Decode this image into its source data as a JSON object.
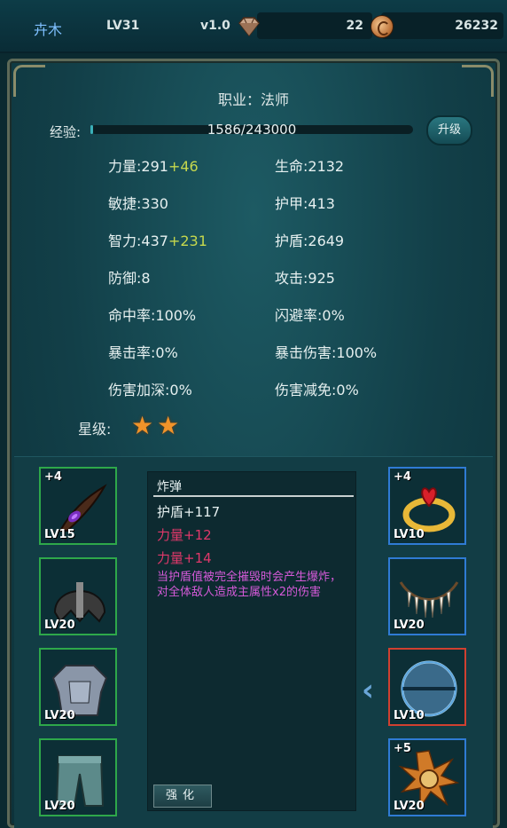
{
  "topbar": {
    "name": "卉木",
    "level": "LV31",
    "version": "v1.0",
    "gems": "22",
    "coins": "26232",
    "gem_icon": "diamond-icon",
    "coin_icon": "coin-icon"
  },
  "character": {
    "profession": "职业：法师",
    "exp_label": "经验:",
    "exp_text": "1586/243000",
    "exp_fraction": 0.0065,
    "upgrade_label": "升级"
  },
  "stats_left": [
    {
      "label": "力量:291",
      "bonus": "+46"
    },
    {
      "label": "敏捷:330",
      "bonus": ""
    },
    {
      "label": "智力:437",
      "bonus": "+231"
    },
    {
      "label": "防御:8",
      "bonus": ""
    },
    {
      "label": "命中率:100%",
      "bonus": ""
    },
    {
      "label": "暴击率:0%",
      "bonus": ""
    },
    {
      "label": "伤害加深:0%",
      "bonus": ""
    }
  ],
  "stats_right": [
    {
      "label": "生命:2132"
    },
    {
      "label": "护甲:413"
    },
    {
      "label": "护盾:2649"
    },
    {
      "label": "攻击:925"
    },
    {
      "label": "闪避率:0%"
    },
    {
      "label": "暴击伤害:100%"
    },
    {
      "label": "伤害减免:0%"
    }
  ],
  "star_label": "星级:",
  "star_count": 2,
  "left_slots": [
    {
      "plus": "+4",
      "lv": "LV15",
      "icon": "dagger-icon",
      "border": "green"
    },
    {
      "plus": "",
      "lv": "LV20",
      "icon": "helmet-icon",
      "border": "green"
    },
    {
      "plus": "",
      "lv": "LV20",
      "icon": "armor-icon",
      "border": "green"
    },
    {
      "plus": "",
      "lv": "LV20",
      "icon": "pants-icon",
      "border": "green"
    }
  ],
  "right_slots": [
    {
      "plus": "+4",
      "lv": "LV10",
      "icon": "ring-icon",
      "border": "blue"
    },
    {
      "plus": "",
      "lv": "LV20",
      "icon": "necklace-icon",
      "border": "blue"
    },
    {
      "plus": "",
      "lv": "LV10",
      "icon": "shield-orb-icon",
      "border": "red"
    },
    {
      "plus": "+5",
      "lv": "LV20",
      "icon": "amulet-icon",
      "border": "blue"
    }
  ],
  "detail": {
    "title": "炸弹",
    "lines": [
      {
        "text": "护盾+117",
        "color": "#e6f0f0"
      },
      {
        "text": "力量+12",
        "color": "#e0386a"
      },
      {
        "text": "力量+14",
        "color": "#e0386a"
      }
    ],
    "description": "当护盾值被完全摧毁时会产生爆炸，对全体敌人造成主属性x2的伤害",
    "button_label": "强化"
  },
  "colors": {
    "panel_bg": "#123f48",
    "bonus": "#c6d84d",
    "green_border": "#2ea84a",
    "blue_border": "#2f7bd4",
    "red_border": "#d04030",
    "magenta_text": "#d45ad8",
    "red_text": "#e0386a"
  }
}
